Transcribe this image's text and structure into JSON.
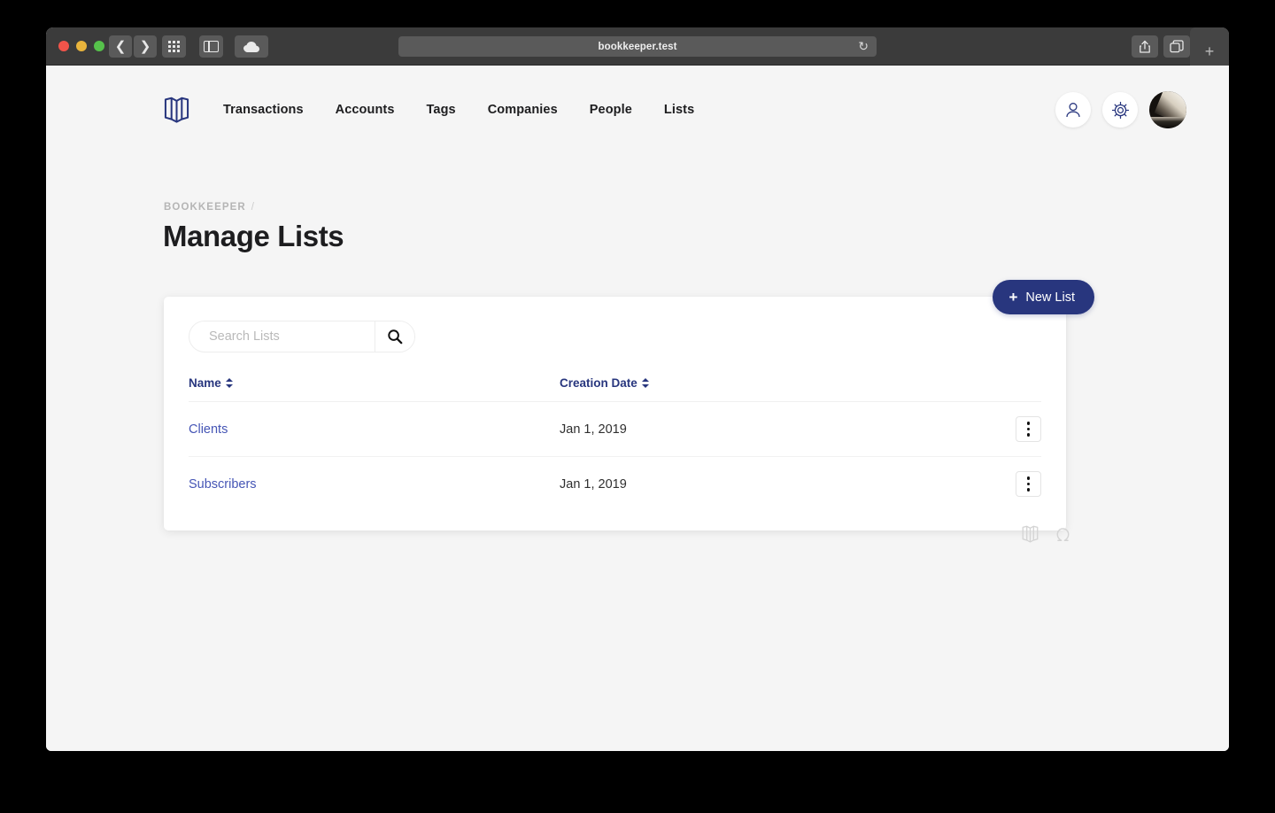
{
  "browser": {
    "url": "bookkeeper.test",
    "reload_icon": "reload-icon",
    "back_icon": "chevron-left-icon",
    "forward_icon": "chevron-right-icon",
    "grid_icon": "grid-icon",
    "sidebar_icon": "sidebar-toggle-icon",
    "cloud_icon": "cloud-icon",
    "share_icon": "share-icon",
    "tabs_icon": "tab-overview-icon",
    "newtab_label": "+"
  },
  "app": {
    "logo_icon": "open-book-logo-icon",
    "nav": [
      {
        "label": "Transactions"
      },
      {
        "label": "Accounts"
      },
      {
        "label": "Tags"
      },
      {
        "label": "Companies"
      },
      {
        "label": "People"
      },
      {
        "label": "Lists"
      }
    ],
    "header_actions": {
      "profile_icon": "person-icon",
      "settings_icon": "gear-icon",
      "avatar_icon": "user-avatar"
    }
  },
  "breadcrumb": {
    "root": "BOOKKEEPER",
    "separator": "/"
  },
  "page_title": "Manage Lists",
  "actions": {
    "new_list_label": "New List",
    "new_list_plus": "+"
  },
  "search": {
    "placeholder": "Search Lists",
    "value": "",
    "icon": "search-icon"
  },
  "table": {
    "columns": [
      {
        "label": "Name"
      },
      {
        "label": "Creation Date"
      },
      {
        "label": ""
      }
    ],
    "rows": [
      {
        "name": "Clients",
        "creation_date": "Jan 1, 2019",
        "menu_icon": "kebab-menu-icon"
      },
      {
        "name": "Subscribers",
        "creation_date": "Jan 1, 2019",
        "menu_icon": "kebab-menu-icon"
      }
    ]
  },
  "footer": {
    "book_icon": "open-book-icon",
    "omega_icon": "omega-icon"
  },
  "colors": {
    "brand_navy": "#28367e",
    "link_blue": "#4555b5",
    "page_bg": "#f5f5f5",
    "card_bg": "#ffffff",
    "title_text": "#1d1d1f",
    "muted_text": "#b5b5b5"
  }
}
